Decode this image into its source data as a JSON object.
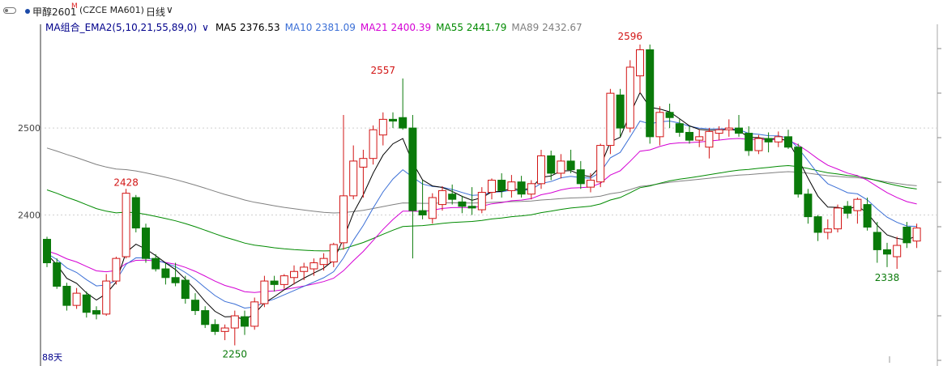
{
  "toolbar": {
    "symbol": "甲醇2601",
    "mark": "M",
    "code": "(CZCE MA601)",
    "period": "日线",
    "period_chevron": "∨"
  },
  "ma_legend": {
    "group": "MA组合_EMA2(5,10,21,55,89,0)",
    "group_chevron": "∨",
    "items": [
      {
        "label": "MA5 2376.53",
        "color": "#000000"
      },
      {
        "label": "MA10 2381.09",
        "color": "#3b6fd6"
      },
      {
        "label": "MA21 2400.39",
        "color": "#d400d4"
      },
      {
        "label": "MA55 2441.79",
        "color": "#008a00"
      },
      {
        "label": "MA89 2432.67",
        "color": "#808080"
      }
    ]
  },
  "footer": {
    "days": "88天"
  },
  "colors": {
    "up": "#d21414",
    "down": "#0a7a0a",
    "grid": "#cfcfcf"
  },
  "chart_data": {
    "type": "candlestick",
    "ylim": [
      2230,
      2610
    ],
    "yticks": [
      2400,
      2500
    ],
    "grid": "horizontal dotted",
    "annotations": [
      {
        "label": "2596",
        "index": 59,
        "price": 2596,
        "position": "above",
        "color": "#d21414"
      },
      {
        "label": "2557",
        "index": 34,
        "price": 2557,
        "position": "above",
        "color": "#d21414"
      },
      {
        "label": "2428",
        "index": 8,
        "price": 2428,
        "position": "above",
        "color": "#d21414"
      },
      {
        "label": "2250",
        "index": 19,
        "price": 2250,
        "position": "below",
        "color": "#0a7a0a"
      },
      {
        "label": "2338",
        "index": 85,
        "price": 2338,
        "position": "below",
        "color": "#0a7a0a"
      }
    ],
    "ohlc": [
      [
        2372,
        2375,
        2340,
        2345
      ],
      [
        2345,
        2350,
        2315,
        2318
      ],
      [
        2318,
        2322,
        2290,
        2296
      ],
      [
        2296,
        2316,
        2292,
        2310
      ],
      [
        2308,
        2312,
        2282,
        2288
      ],
      [
        2290,
        2295,
        2280,
        2286
      ],
      [
        2286,
        2332,
        2284,
        2324
      ],
      [
        2324,
        2352,
        2320,
        2350
      ],
      [
        2352,
        2430,
        2350,
        2425
      ],
      [
        2420,
        2423,
        2380,
        2385
      ],
      [
        2385,
        2390,
        2345,
        2350
      ],
      [
        2350,
        2355,
        2335,
        2338
      ],
      [
        2338,
        2345,
        2320,
        2328
      ],
      [
        2328,
        2345,
        2318,
        2322
      ],
      [
        2325,
        2330,
        2298,
        2304
      ],
      [
        2302,
        2310,
        2285,
        2290
      ],
      [
        2290,
        2295,
        2270,
        2274
      ],
      [
        2274,
        2280,
        2262,
        2266
      ],
      [
        2266,
        2274,
        2256,
        2270
      ],
      [
        2270,
        2290,
        2250,
        2284
      ],
      [
        2283,
        2290,
        2262,
        2272
      ],
      [
        2272,
        2305,
        2268,
        2300
      ],
      [
        2298,
        2330,
        2294,
        2324
      ],
      [
        2324,
        2330,
        2312,
        2320
      ],
      [
        2320,
        2332,
        2315,
        2330
      ],
      [
        2328,
        2342,
        2320,
        2335
      ],
      [
        2335,
        2345,
        2325,
        2340
      ],
      [
        2338,
        2350,
        2330,
        2345
      ],
      [
        2343,
        2356,
        2336,
        2350
      ],
      [
        2346,
        2368,
        2340,
        2366
      ],
      [
        2368,
        2515,
        2360,
        2422
      ],
      [
        2422,
        2480,
        2418,
        2462
      ],
      [
        2455,
        2475,
        2420,
        2465
      ],
      [
        2465,
        2503,
        2458,
        2498
      ],
      [
        2492,
        2518,
        2480,
        2510
      ],
      [
        2510,
        2518,
        2500,
        2508
      ],
      [
        2512,
        2557,
        2498,
        2500
      ],
      [
        2500,
        2515,
        2350,
        2405
      ],
      [
        2405,
        2440,
        2395,
        2400
      ],
      [
        2396,
        2425,
        2390,
        2420
      ],
      [
        2412,
        2433,
        2405,
        2428
      ],
      [
        2424,
        2435,
        2412,
        2418
      ],
      [
        2415,
        2422,
        2402,
        2410
      ],
      [
        2410,
        2432,
        2400,
        2408
      ],
      [
        2406,
        2432,
        2402,
        2426
      ],
      [
        2426,
        2442,
        2418,
        2440
      ],
      [
        2440,
        2448,
        2420,
        2428
      ],
      [
        2428,
        2446,
        2420,
        2438
      ],
      [
        2438,
        2445,
        2420,
        2424
      ],
      [
        2424,
        2440,
        2418,
        2436
      ],
      [
        2436,
        2475,
        2430,
        2468
      ],
      [
        2468,
        2474,
        2440,
        2448
      ],
      [
        2448,
        2470,
        2442,
        2462
      ],
      [
        2462,
        2475,
        2448,
        2452
      ],
      [
        2452,
        2462,
        2430,
        2436
      ],
      [
        2432,
        2448,
        2426,
        2440
      ],
      [
        2438,
        2482,
        2432,
        2480
      ],
      [
        2480,
        2545,
        2470,
        2540
      ],
      [
        2538,
        2545,
        2490,
        2500
      ],
      [
        2500,
        2578,
        2495,
        2570
      ],
      [
        2560,
        2596,
        2540,
        2590
      ],
      [
        2590,
        2596,
        2482,
        2490
      ],
      [
        2490,
        2525,
        2480,
        2518
      ],
      [
        2518,
        2528,
        2500,
        2512
      ],
      [
        2505,
        2510,
        2490,
        2495
      ],
      [
        2495,
        2502,
        2482,
        2486
      ],
      [
        2486,
        2498,
        2478,
        2490
      ],
      [
        2478,
        2500,
        2465,
        2496
      ],
      [
        2494,
        2502,
        2486,
        2498
      ],
      [
        2498,
        2510,
        2490,
        2500
      ],
      [
        2500,
        2515,
        2490,
        2494
      ],
      [
        2494,
        2502,
        2468,
        2474
      ],
      [
        2474,
        2492,
        2470,
        2488
      ],
      [
        2488,
        2495,
        2472,
        2484
      ],
      [
        2484,
        2496,
        2478,
        2490
      ],
      [
        2490,
        2498,
        2476,
        2478
      ],
      [
        2478,
        2482,
        2420,
        2424
      ],
      [
        2424,
        2430,
        2390,
        2398
      ],
      [
        2398,
        2400,
        2370,
        2380
      ],
      [
        2380,
        2395,
        2372,
        2384
      ],
      [
        2384,
        2412,
        2380,
        2408
      ],
      [
        2410,
        2416,
        2396,
        2402
      ],
      [
        2405,
        2420,
        2390,
        2418
      ],
      [
        2412,
        2420,
        2382,
        2386
      ],
      [
        2380,
        2392,
        2345,
        2360
      ],
      [
        2360,
        2368,
        2340,
        2355
      ],
      [
        2352,
        2375,
        2338,
        2365
      ],
      [
        2386,
        2392,
        2362,
        2368
      ],
      [
        2370,
        2390,
        2362,
        2385
      ]
    ],
    "ma_series_values": {
      "MA5": 2376.53,
      "MA10": 2381.09,
      "MA21": 2400.39,
      "MA55": 2441.79,
      "MA89": 2432.67
    }
  }
}
